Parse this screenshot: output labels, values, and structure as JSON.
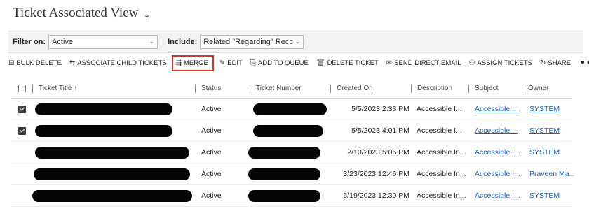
{
  "view": {
    "title": "Ticket Associated View",
    "chevron_icon": "chevron-down-icon"
  },
  "filter": {
    "filter_label": "Filter on:",
    "filter_value": "Active",
    "include_label": "Include:",
    "include_value": "Related \"Regarding\" Records"
  },
  "toolbar": {
    "items": [
      {
        "label": "BULK DELETE",
        "icon": "bulk-delete-icon"
      },
      {
        "label": "ASSOCIATE CHILD TICKETS",
        "icon": "associate-icon"
      },
      {
        "label": "MERGE",
        "icon": "merge-icon",
        "highlighted": true,
        "highlight_color": "#d9342b"
      },
      {
        "label": "EDIT",
        "icon": "pencil-icon"
      },
      {
        "label": "ADD TO QUEUE",
        "icon": "add-to-queue-icon"
      },
      {
        "label": "DELETE TICKET",
        "icon": "trash-icon"
      },
      {
        "label": "SEND DIRECT EMAIL",
        "icon": "email-icon"
      },
      {
        "label": "ASSIGN TICKETS",
        "icon": "assign-icon"
      },
      {
        "label": "SHARE",
        "icon": "share-icon"
      }
    ],
    "more_label": "•••"
  },
  "grid": {
    "columns": [
      "Ticket Title ↑",
      "Status",
      "Ticket Number",
      "Created On",
      "Description",
      "Subject",
      "Owner"
    ],
    "rows": [
      {
        "checked": true,
        "status": "Active",
        "created_on": "5/5/2023 2:33 PM",
        "description": "Accessible I...",
        "subject": "Accessible ...",
        "owner": "SYSTEM",
        "link_style": "underline"
      },
      {
        "checked": true,
        "status": "Active",
        "created_on": "5/5/2023 4:01 PM",
        "description": "Accessible I...",
        "subject": "Accessible ...",
        "owner": "SYSTEM",
        "link_style": "underline"
      },
      {
        "checked": false,
        "status": "Active",
        "created_on": "2/10/2023 5:05 PM",
        "description": "Accessible In...",
        "subject": "Accessible I...",
        "owner": "SYSTEM",
        "link_style": "plain"
      },
      {
        "checked": false,
        "status": "Active",
        "created_on": "3/23/2023 12:46 PM",
        "description": "Accessible In...",
        "subject": "Accessible I...",
        "owner": "Praveen Ma...",
        "link_style": "plain"
      },
      {
        "checked": false,
        "status": "Active",
        "created_on": "6/19/2023 12:30 PM",
        "description": "Accessible In...",
        "subject": "Accessible I...",
        "owner": "SYSTEM",
        "link_style": "plain"
      }
    ],
    "redacted_color": "#050505",
    "link_color": "#1f5fb7"
  }
}
